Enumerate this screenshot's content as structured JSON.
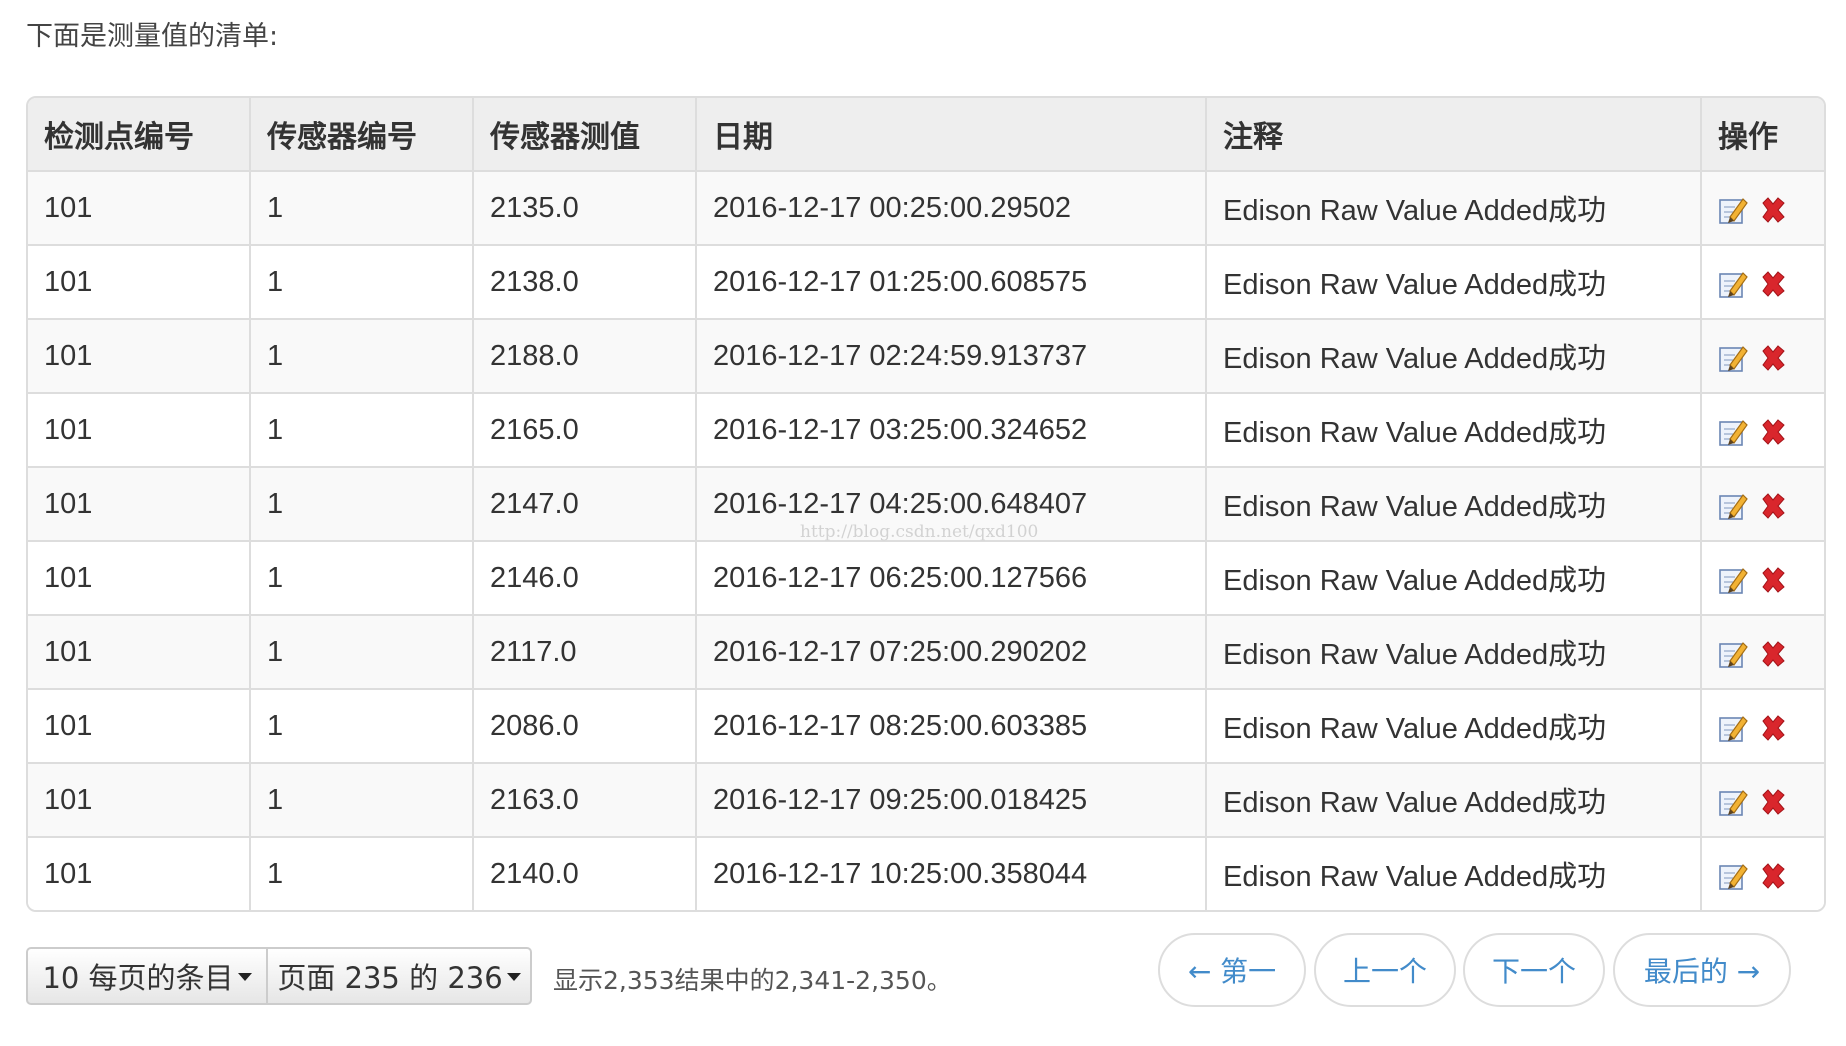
{
  "intro_text": "下面是测量值的清单:",
  "table": {
    "columns": [
      "检测点编号",
      "传感器编号",
      "传感器测值",
      "日期",
      "注释",
      "操作"
    ],
    "rows": [
      {
        "point": "101",
        "sensor": "1",
        "value": "2135.0",
        "date": "2016-12-17 00:25:00.29502",
        "note": "Edison Raw Value Added成功"
      },
      {
        "point": "101",
        "sensor": "1",
        "value": "2138.0",
        "date": "2016-12-17 01:25:00.608575",
        "note": "Edison Raw Value Added成功"
      },
      {
        "point": "101",
        "sensor": "1",
        "value": "2188.0",
        "date": "2016-12-17 02:24:59.913737",
        "note": "Edison Raw Value Added成功"
      },
      {
        "point": "101",
        "sensor": "1",
        "value": "2165.0",
        "date": "2016-12-17 03:25:00.324652",
        "note": "Edison Raw Value Added成功"
      },
      {
        "point": "101",
        "sensor": "1",
        "value": "2147.0",
        "date": "2016-12-17 04:25:00.648407",
        "note": "Edison Raw Value Added成功"
      },
      {
        "point": "101",
        "sensor": "1",
        "value": "2146.0",
        "date": "2016-12-17 06:25:00.127566",
        "note": "Edison Raw Value Added成功"
      },
      {
        "point": "101",
        "sensor": "1",
        "value": "2117.0",
        "date": "2016-12-17 07:25:00.290202",
        "note": "Edison Raw Value Added成功"
      },
      {
        "point": "101",
        "sensor": "1",
        "value": "2086.0",
        "date": "2016-12-17 08:25:00.603385",
        "note": "Edison Raw Value Added成功"
      },
      {
        "point": "101",
        "sensor": "1",
        "value": "2163.0",
        "date": "2016-12-17 09:25:00.018425",
        "note": "Edison Raw Value Added成功"
      },
      {
        "point": "101",
        "sensor": "1",
        "value": "2140.0",
        "date": "2016-12-17 10:25:00.358044",
        "note": "Edison Raw Value Added成功"
      }
    ],
    "row_actions": {
      "edit_icon": "edit-icon",
      "delete_icon": "delete-icon"
    }
  },
  "watermark": "http://blog.csdn.net/qxd100",
  "footer": {
    "per_page_label": "10 每页的条目",
    "page_select_label": "页面 235 的 236",
    "summary": "显示2,353结果中的2,341-2,350。",
    "pager": {
      "first": "← 第一",
      "prev": "上一个",
      "next": "下一个",
      "last": "最后的 →"
    }
  },
  "colors": {
    "link": "#428bca",
    "delete": "#d9262c",
    "header_bg": "#eeeeee",
    "stripe_bg": "#f9f9f9",
    "border": "#dddddd"
  }
}
